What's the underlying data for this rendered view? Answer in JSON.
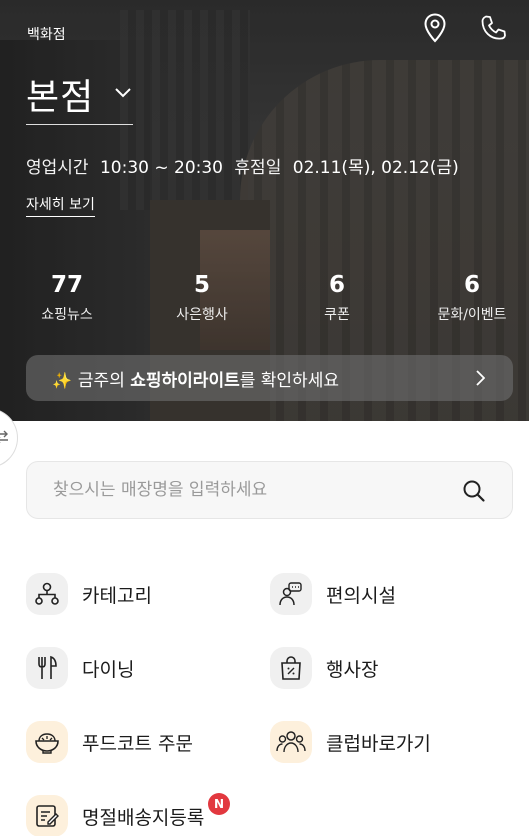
{
  "header": {
    "store_type": "백화점",
    "branch": "본점",
    "hours_label": "영업시간",
    "hours_value": "10:30 ~ 20:30",
    "closed_label": "휴점일",
    "closed_value": "02.11(목), 02.12(금)",
    "detail_link": "자세히 보기"
  },
  "stats": [
    {
      "num": "77",
      "label": "쇼핑뉴스"
    },
    {
      "num": "5",
      "label": "사은행사"
    },
    {
      "num": "6",
      "label": "쿠폰"
    },
    {
      "num": "6",
      "label": "문화/이벤트"
    }
  ],
  "highlight": {
    "sparkle": "✨",
    "prefix": "금주의 ",
    "bold": "쇼핑하이라이트",
    "suffix": "를 확인하세요"
  },
  "search": {
    "placeholder": "찾으시는 매장명을 입력하세요"
  },
  "menu": [
    {
      "label": "카테고리",
      "icon": "category-tree-icon"
    },
    {
      "label": "편의시설",
      "icon": "concierge-icon"
    },
    {
      "label": "다이닝",
      "icon": "fork-knife-icon"
    },
    {
      "label": "행사장",
      "icon": "sale-bag-icon"
    },
    {
      "label": "푸드코트 주문",
      "icon": "food-bowl-icon"
    },
    {
      "label": "클럽바로가기",
      "icon": "members-icon"
    },
    {
      "label": "명절배송지등록",
      "icon": "register-pen-icon"
    }
  ],
  "badge": "N",
  "colors": {
    "badge": "#e2383f",
    "warm_icon_bg": "#fdf0dc",
    "icon_bg": "#f0f0f0",
    "sparkle": "#f5d35a"
  }
}
